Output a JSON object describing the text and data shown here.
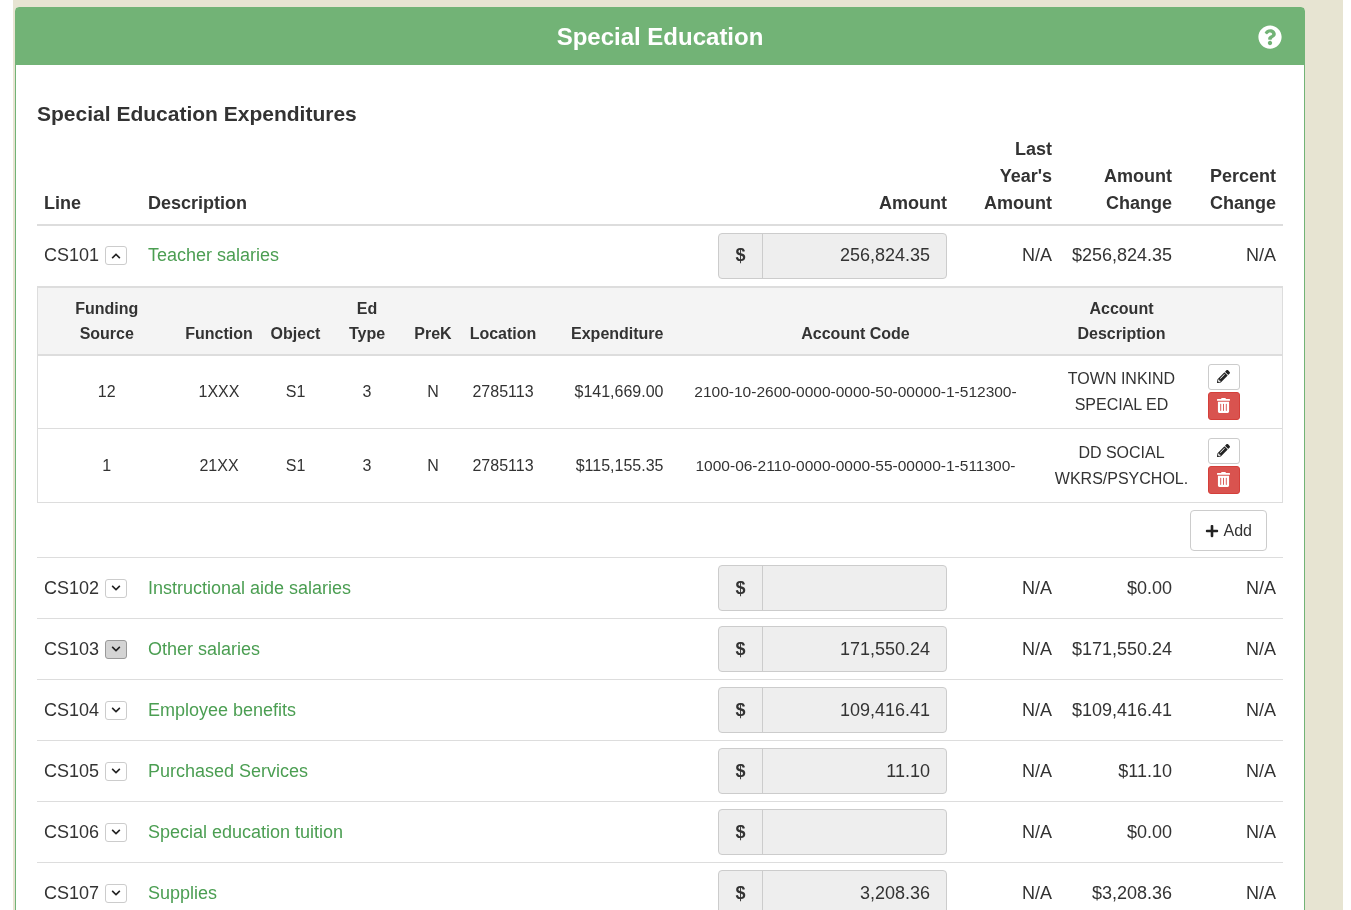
{
  "panel": {
    "title": "Special Education"
  },
  "section_title": "Special Education Expenditures",
  "columns": [
    "Line",
    "Description",
    "Amount",
    "Last Year's Amount",
    "Amount Change",
    "Percent Change"
  ],
  "lines": [
    {
      "line": "CS101",
      "description": "Teacher salaries",
      "expanded": true,
      "pressed": false,
      "currency": "$",
      "amount": "256,824.35",
      "last_year": "N/A",
      "amount_change": "$256,824.35",
      "percent_change": "N/A",
      "details": {
        "columns": [
          "Funding Source",
          "Function",
          "Object",
          "Ed Type",
          "PreK",
          "Location",
          "Expenditure",
          "Account Code",
          "Account Description"
        ],
        "rows": [
          {
            "cells": [
              "12",
              "1XXX",
              "S1",
              "3",
              "N",
              "2785113",
              "$141,669.00",
              "2100-10-2600-0000-0000-50-00000-1-512300-",
              "TOWN INKIND SPECIAL ED"
            ]
          },
          {
            "cells": [
              "1",
              "21XX",
              "S1",
              "3",
              "N",
              "2785113",
              "$115,155.35",
              "1000-06-2110-0000-0000-55-00000-1-511300-",
              "DD SOCIAL WKRS/PSYCHOL."
            ]
          }
        ],
        "add_label": "Add"
      }
    },
    {
      "line": "CS102",
      "description": "Instructional aide salaries",
      "expanded": false,
      "pressed": false,
      "currency": "$",
      "last_year": "N/A",
      "amount_change": "$0.00",
      "percent_change": "N/A"
    },
    {
      "line": "CS103",
      "description": "Other salaries",
      "expanded": false,
      "pressed": true,
      "currency": "$",
      "amount": "171,550.24",
      "last_year": "N/A",
      "amount_change": "$171,550.24",
      "percent_change": "N/A"
    },
    {
      "line": "CS104",
      "description": "Employee benefits",
      "expanded": false,
      "pressed": false,
      "currency": "$",
      "amount": "109,416.41",
      "last_year": "N/A",
      "amount_change": "$109,416.41",
      "percent_change": "N/A"
    },
    {
      "line": "CS105",
      "description": "Purchased Services",
      "expanded": false,
      "pressed": false,
      "currency": "$",
      "amount": "11.10",
      "last_year": "N/A",
      "amount_change": "$11.10",
      "percent_change": "N/A"
    },
    {
      "line": "CS106",
      "description": "Special education tuition",
      "expanded": false,
      "pressed": false,
      "currency": "$",
      "last_year": "N/A",
      "amount_change": "$0.00",
      "percent_change": "N/A"
    },
    {
      "line": "CS107",
      "description": "Supplies",
      "expanded": false,
      "pressed": false,
      "currency": "$",
      "amount": "3,208.36",
      "last_year": "N/A",
      "amount_change": "$3,208.36",
      "percent_change": "N/A"
    }
  ]
}
